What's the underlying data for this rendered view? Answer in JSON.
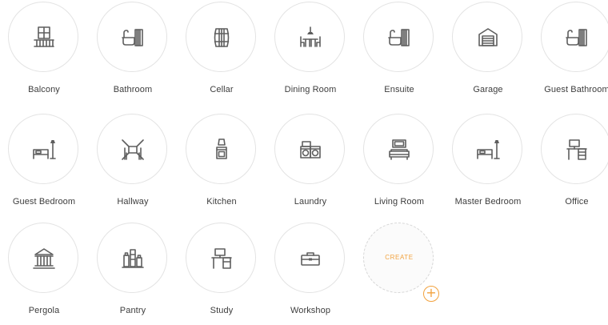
{
  "rooms": [
    {
      "label": "Balcony",
      "icon": "balcony-icon"
    },
    {
      "label": "Bathroom",
      "icon": "bathtub-icon"
    },
    {
      "label": "Cellar",
      "icon": "barrel-icon"
    },
    {
      "label": "Dining Room",
      "icon": "dining-table-icon"
    },
    {
      "label": "Ensuite",
      "icon": "bathtub-icon"
    },
    {
      "label": "Garage",
      "icon": "garage-icon"
    },
    {
      "label": "Guest Bathroom",
      "icon": "bathtub-icon"
    },
    {
      "label": "Guest Bedroom",
      "icon": "bed-lamp-icon"
    },
    {
      "label": "Hallway",
      "icon": "hallway-icon"
    },
    {
      "label": "Kitchen",
      "icon": "oven-hood-icon"
    },
    {
      "label": "Laundry",
      "icon": "washing-machines-icon"
    },
    {
      "label": "Living Room",
      "icon": "sofa-tv-icon"
    },
    {
      "label": "Master Bedroom",
      "icon": "bed-lamp-icon"
    },
    {
      "label": "Office",
      "icon": "desk-computer-icon"
    },
    {
      "label": "Pergola",
      "icon": "pergola-icon"
    },
    {
      "label": "Pantry",
      "icon": "jars-icon"
    },
    {
      "label": "Study",
      "icon": "study-desk-icon"
    },
    {
      "label": "Workshop",
      "icon": "toolbox-icon"
    }
  ],
  "create": {
    "label": "CREATE",
    "plus": "+",
    "icon": "plus-icon"
  },
  "colors": {
    "accent": "#f2a23e",
    "icon": "#5e5e5e",
    "circle_border": "#e3e3e3",
    "label": "#3d3d3d"
  }
}
